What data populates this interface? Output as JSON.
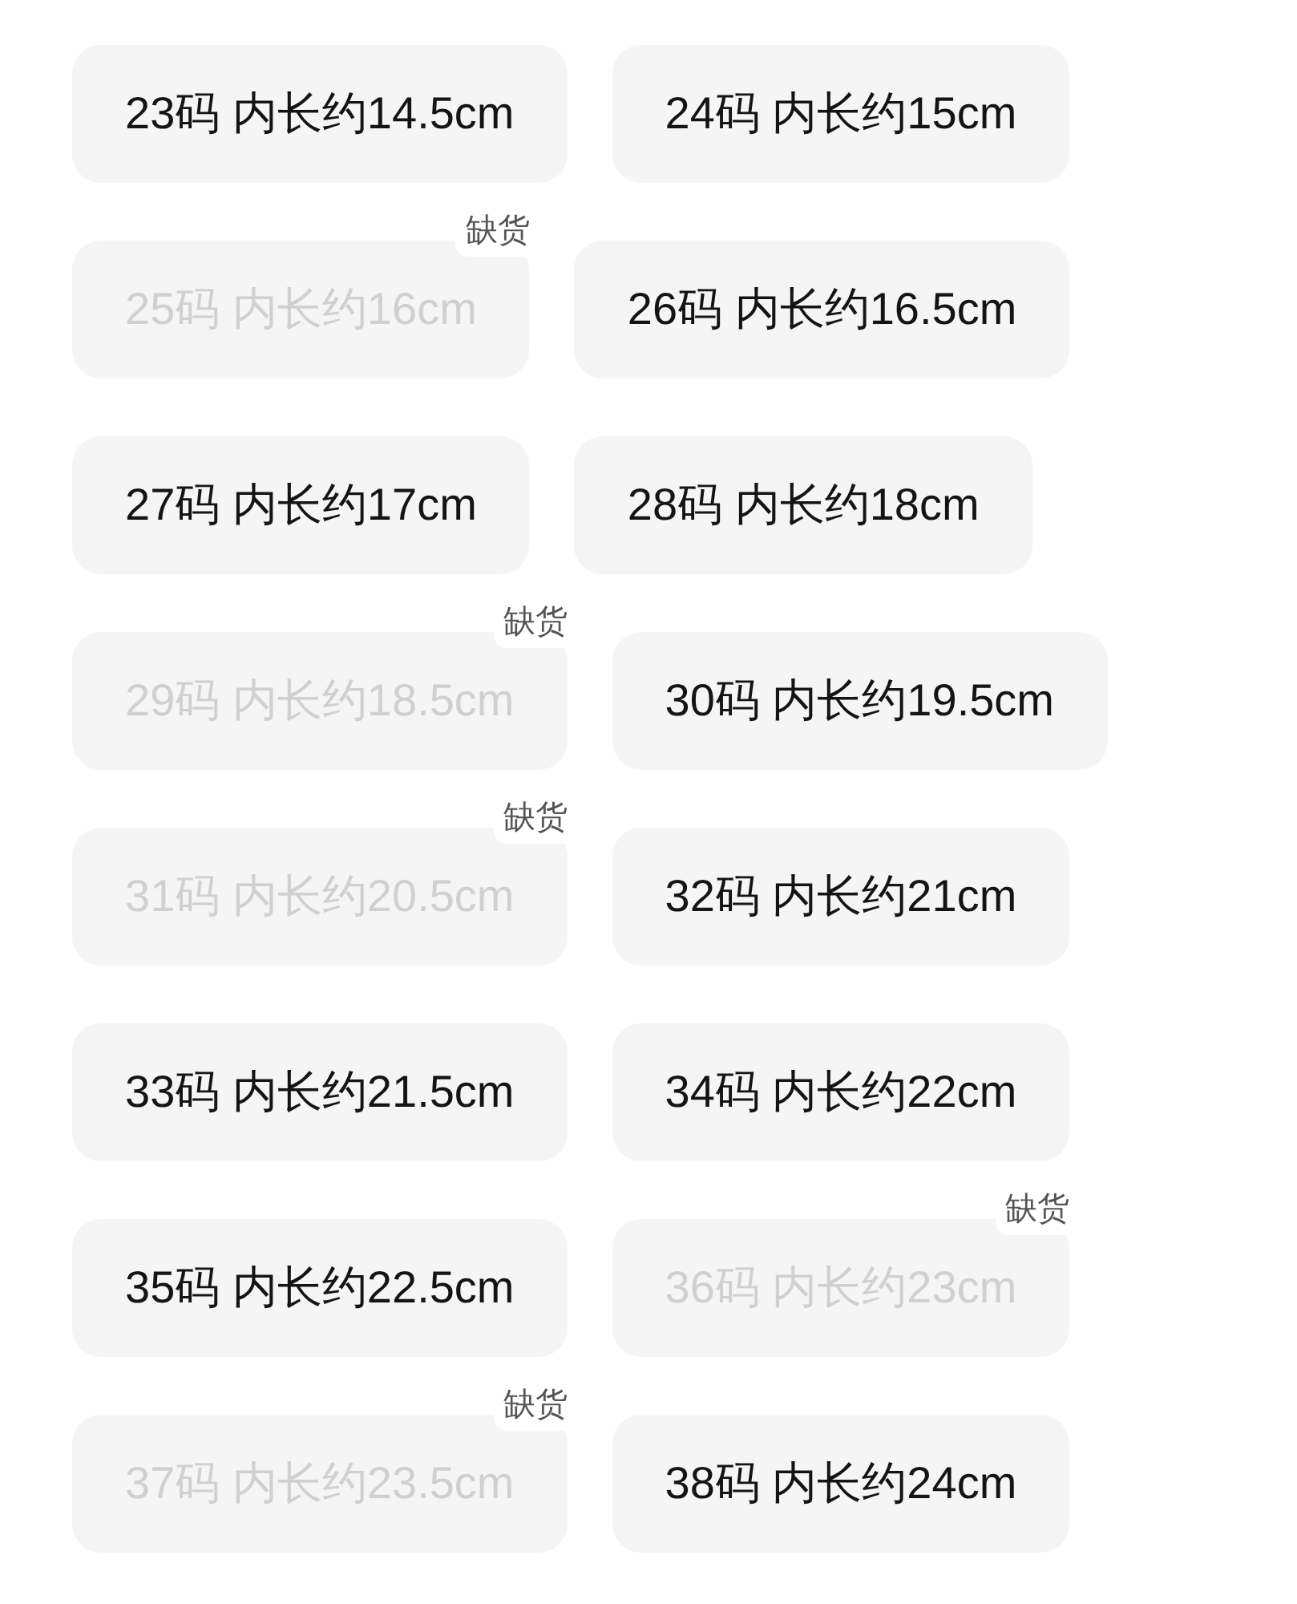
{
  "rows": [
    {
      "sizes": [
        {
          "label": "23码 内长约14.5cm",
          "disabled": false
        },
        {
          "label": "24码 内长约15cm",
          "disabled": false
        }
      ]
    },
    {
      "sizes": [
        {
          "label": "25码 内长约16cm",
          "disabled": true,
          "badge": "缺货"
        },
        {
          "label": "26码 内长约16.5cm",
          "disabled": false
        }
      ]
    },
    {
      "sizes": [
        {
          "label": "27码 内长约17cm",
          "disabled": false
        },
        {
          "label": "28码 内长约18cm",
          "disabled": false
        }
      ]
    },
    {
      "sizes": [
        {
          "label": "29码 内长约18.5cm",
          "disabled": true,
          "badge": "缺货"
        },
        {
          "label": "30码 内长约19.5cm",
          "disabled": false
        }
      ]
    },
    {
      "sizes": [
        {
          "label": "31码 内长约20.5cm",
          "disabled": true,
          "badge": "缺货"
        },
        {
          "label": "32码 内长约21cm",
          "disabled": false
        }
      ]
    },
    {
      "sizes": [
        {
          "label": "33码 内长约21.5cm",
          "disabled": false
        },
        {
          "label": "34码 内长约22cm",
          "disabled": false
        }
      ]
    },
    {
      "sizes": [
        {
          "label": "35码 内长约22.5cm",
          "disabled": false
        },
        {
          "label": "36码 内长约23cm",
          "disabled": true,
          "badge": "缺货"
        }
      ]
    },
    {
      "sizes": [
        {
          "label": "37码 内长约23.5cm",
          "disabled": true,
          "badge": "缺货"
        },
        {
          "label": "38码 内长约24cm",
          "disabled": false
        }
      ]
    }
  ]
}
